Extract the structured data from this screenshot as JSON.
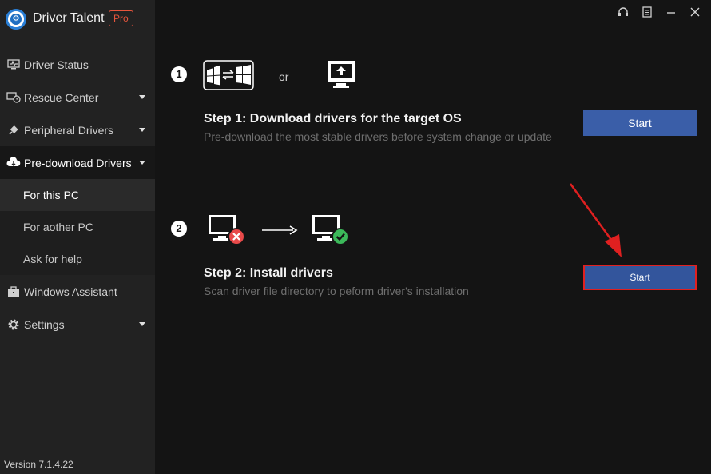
{
  "app": {
    "title": "Driver Talent",
    "badge": "Pro",
    "version": "Version 7.1.4.22"
  },
  "sidebar": {
    "items": [
      {
        "label": "Driver Status",
        "icon": "monitor-pulse-icon"
      },
      {
        "label": "Rescue Center",
        "icon": "restore-icon"
      },
      {
        "label": "Peripheral Drivers",
        "icon": "plug-icon"
      },
      {
        "label": "Pre-download Drivers",
        "icon": "cloud-download-icon"
      },
      {
        "label": "Windows Assistant",
        "icon": "toolbox-icon"
      },
      {
        "label": "Settings",
        "icon": "gear-icon"
      }
    ],
    "subitems": [
      {
        "label": "For this PC"
      },
      {
        "label": "For aother PC"
      },
      {
        "label": "Ask for help"
      }
    ]
  },
  "topbar": {
    "icons": [
      "headset-icon",
      "menu-icon",
      "minimize-icon",
      "close-icon"
    ]
  },
  "main": {
    "or_label": "or",
    "step1": {
      "number": "1",
      "title": "Step 1: Download drivers for the target OS",
      "desc": "Pre-download the most stable drivers before system change or update",
      "button": "Start"
    },
    "step2": {
      "number": "2",
      "title": "Step 2: Install drivers",
      "desc": "Scan driver file directory to peform driver's installation",
      "button": "Start"
    }
  },
  "colors": {
    "accent": "#3a5ea8",
    "highlight": "#e02020",
    "error": "#e84a4a",
    "success": "#3cb95a"
  }
}
